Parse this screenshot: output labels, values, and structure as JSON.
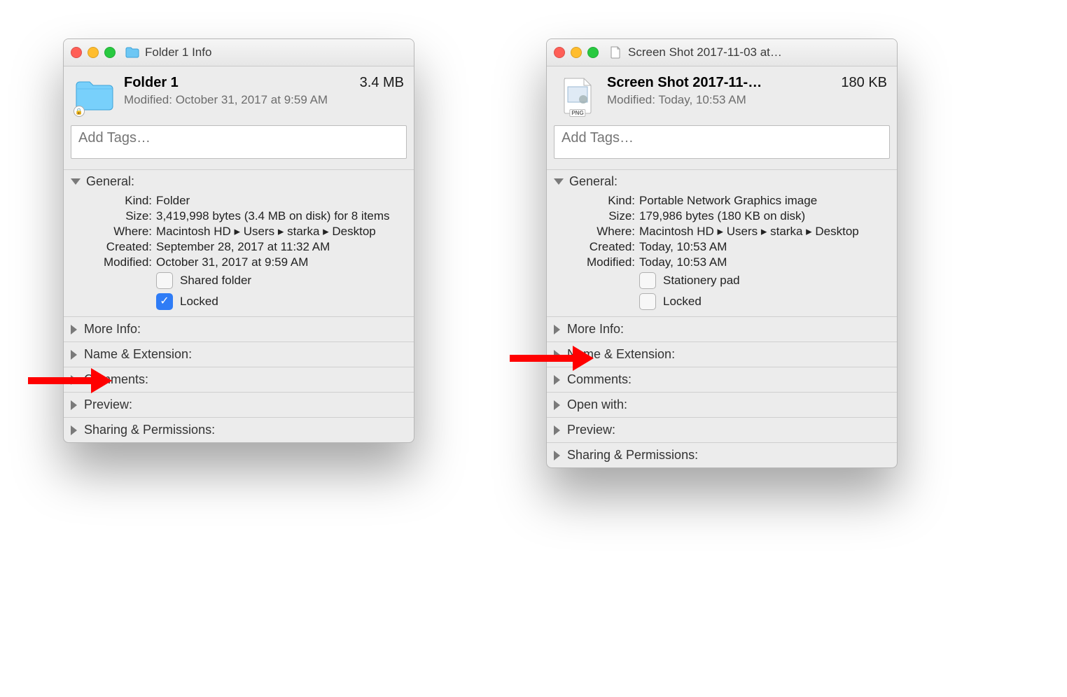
{
  "left": {
    "title": "Folder 1 Info",
    "name": "Folder 1",
    "size": "3.4 MB",
    "modified_header": "Modified: October 31, 2017 at 9:59 AM",
    "tags_placeholder": "Add Tags…",
    "general_label": "General:",
    "kind_label": "Kind:",
    "kind_value": "Folder",
    "size_label": "Size:",
    "size_value": "3,419,998 bytes (3.4 MB on disk) for 8 items",
    "where_label": "Where:",
    "where_value": "Macintosh HD ▸ Users ▸ starka ▸ Desktop",
    "created_label": "Created:",
    "created_value": "September 28, 2017 at 11:32 AM",
    "modified_label": "Modified:",
    "modified_value": "October 31, 2017 at 9:59 AM",
    "shared_label": "Shared folder",
    "locked_label": "Locked",
    "more_info": "More Info:",
    "name_ext": "Name & Extension:",
    "comments": "Comments:",
    "preview": "Preview:",
    "sharing": "Sharing & Permissions:"
  },
  "right": {
    "title": "Screen Shot 2017-11-03 at…",
    "name": "Screen Shot 2017-11-…",
    "size": "180 KB",
    "modified_header": "Modified: Today, 10:53 AM",
    "tags_placeholder": "Add Tags…",
    "general_label": "General:",
    "kind_label": "Kind:",
    "kind_value": "Portable Network Graphics image",
    "size_label": "Size:",
    "size_value": "179,986 bytes (180 KB on disk)",
    "where_label": "Where:",
    "where_value": "Macintosh HD ▸ Users ▸ starka ▸ Desktop",
    "created_label": "Created:",
    "created_value": "Today, 10:53 AM",
    "modified_label": "Modified:",
    "modified_value": "Today, 10:53 AM",
    "stationery_label": "Stationery pad",
    "locked_label": "Locked",
    "more_info": "More Info:",
    "name_ext": "Name & Extension:",
    "comments": "Comments:",
    "open_with": "Open with:",
    "preview": "Preview:",
    "sharing": "Sharing & Permissions:"
  }
}
